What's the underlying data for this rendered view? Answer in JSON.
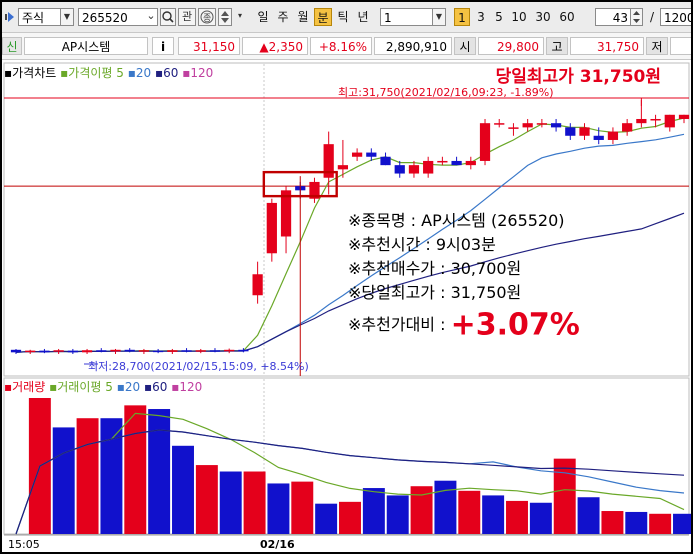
{
  "toolbar": {
    "category": "주식",
    "code": "265520",
    "btn_related": "관",
    "periods": [
      "일",
      "주",
      "월",
      "분",
      "틱",
      "년"
    ],
    "period_selected": "분",
    "interval_value": "1",
    "quick_intervals": [
      "1",
      "3",
      "5",
      "10",
      "30",
      "60"
    ],
    "quick_selected": "1",
    "count_value": "43",
    "total_value": "1200"
  },
  "quote": {
    "type_label": "신",
    "name": "AP시스템",
    "info_label": "i",
    "price": "31,150",
    "change": "▲2,350",
    "change_pct": "+8.16%",
    "volume": "2,890,910",
    "open_label": "시",
    "open": "29,800",
    "high_label": "고",
    "high": "31,750",
    "low_label": "저"
  },
  "legend_price": {
    "title": "가격차트",
    "ma_label": "가격이평 5",
    "ma2": "20",
    "ma3": "60",
    "ma4": "120"
  },
  "legend_volume": {
    "title": "거래량",
    "ma_label": "거래이평 5",
    "ma2": "20",
    "ma3": "60",
    "ma4": "120"
  },
  "annotations": {
    "day_high_title": "당일최고가 31,750원",
    "high_marker": "최고:31,750(2021/02/16,09:23, -1.89%)",
    "low_marker": "최저:28,700(2021/02/15,15:09, +8.54%)"
  },
  "info": {
    "row1": "※종목명 : AP시스템 (265520)",
    "row2": "※추천시간 : 9시03분",
    "row3": "※추천매수가 : 30,700원",
    "row4": "※당일최고가 : 31,750원",
    "row5_label": "※추천가대비 :",
    "row5_value": "+3.07%"
  },
  "x_labels": [
    "15:05",
    "02/16"
  ],
  "colors": {
    "up": "#e4001b",
    "down": "#1111cc",
    "ma5": "#6aa828",
    "ma20": "#3a78c9",
    "ma60": "#202080",
    "ma120": "#c040a0"
  },
  "chart_data": {
    "type": "candlestick",
    "price_high": 31750,
    "price_low": 28700,
    "recommend_price": 30700,
    "candles": [
      {
        "o": 28750,
        "h": 28760,
        "l": 28700,
        "c": 28720
      },
      {
        "o": 28730,
        "h": 28750,
        "l": 28700,
        "c": 28740
      },
      {
        "o": 28740,
        "h": 28760,
        "l": 28710,
        "c": 28720
      },
      {
        "o": 28730,
        "h": 28760,
        "l": 28700,
        "c": 28745
      },
      {
        "o": 28740,
        "h": 28760,
        "l": 28700,
        "c": 28720
      },
      {
        "o": 28720,
        "h": 28760,
        "l": 28700,
        "c": 28745
      },
      {
        "o": 28745,
        "h": 28770,
        "l": 28720,
        "c": 28730
      },
      {
        "o": 28730,
        "h": 28760,
        "l": 28700,
        "c": 28750
      },
      {
        "o": 28750,
        "h": 28770,
        "l": 28720,
        "c": 28730
      },
      {
        "o": 28730,
        "h": 28760,
        "l": 28700,
        "c": 28745
      },
      {
        "o": 28740,
        "h": 28760,
        "l": 28710,
        "c": 28725
      },
      {
        "o": 28725,
        "h": 28760,
        "l": 28700,
        "c": 28745
      },
      {
        "o": 28745,
        "h": 28770,
        "l": 28720,
        "c": 28730
      },
      {
        "o": 28730,
        "h": 28760,
        "l": 28710,
        "c": 28745
      },
      {
        "o": 28745,
        "h": 28770,
        "l": 28720,
        "c": 28735
      },
      {
        "o": 28735,
        "h": 28765,
        "l": 28710,
        "c": 28750
      },
      {
        "o": 28750,
        "h": 28770,
        "l": 28720,
        "c": 28732
      },
      {
        "o": 29400,
        "h": 29800,
        "l": 29300,
        "c": 29650
      },
      {
        "o": 29900,
        "h": 30550,
        "l": 29800,
        "c": 30500
      },
      {
        "o": 30100,
        "h": 30700,
        "l": 29900,
        "c": 30650
      },
      {
        "o": 30700,
        "h": 30750,
        "l": 30550,
        "c": 30650
      },
      {
        "o": 30550,
        "h": 30800,
        "l": 30500,
        "c": 30750
      },
      {
        "o": 30800,
        "h": 31350,
        "l": 30600,
        "c": 31200
      },
      {
        "o": 30900,
        "h": 31250,
        "l": 30800,
        "c": 30950
      },
      {
        "o": 31050,
        "h": 31150,
        "l": 31000,
        "c": 31100
      },
      {
        "o": 31100,
        "h": 31150,
        "l": 31000,
        "c": 31050
      },
      {
        "o": 31050,
        "h": 31100,
        "l": 30950,
        "c": 30950
      },
      {
        "o": 30950,
        "h": 31000,
        "l": 30800,
        "c": 30850
      },
      {
        "o": 30850,
        "h": 31000,
        "l": 30800,
        "c": 30950
      },
      {
        "o": 30850,
        "h": 31050,
        "l": 30800,
        "c": 31000
      },
      {
        "o": 31000,
        "h": 31050,
        "l": 30950,
        "c": 31000
      },
      {
        "o": 31000,
        "h": 31050,
        "l": 30950,
        "c": 30950
      },
      {
        "o": 30950,
        "h": 31050,
        "l": 30900,
        "c": 31000
      },
      {
        "o": 31000,
        "h": 31500,
        "l": 30950,
        "c": 31450
      },
      {
        "o": 31450,
        "h": 31500,
        "l": 31400,
        "c": 31450
      },
      {
        "o": 31400,
        "h": 31450,
        "l": 31300,
        "c": 31400
      },
      {
        "o": 31400,
        "h": 31500,
        "l": 31350,
        "c": 31450
      },
      {
        "o": 31450,
        "h": 31500,
        "l": 31400,
        "c": 31450
      },
      {
        "o": 31450,
        "h": 31500,
        "l": 31350,
        "c": 31400
      },
      {
        "o": 31400,
        "h": 31450,
        "l": 31250,
        "c": 31300
      },
      {
        "o": 31300,
        "h": 31450,
        "l": 31250,
        "c": 31400
      },
      {
        "o": 31300,
        "h": 31400,
        "l": 31200,
        "c": 31250
      },
      {
        "o": 31250,
        "h": 31400,
        "l": 31200,
        "c": 31350
      },
      {
        "o": 31350,
        "h": 31500,
        "l": 31300,
        "c": 31450
      },
      {
        "o": 31450,
        "h": 31750,
        "l": 31400,
        "c": 31500
      },
      {
        "o": 31500,
        "h": 31550,
        "l": 31400,
        "c": 31500
      },
      {
        "o": 31400,
        "h": 31550,
        "l": 31350,
        "c": 31550
      },
      {
        "o": 31500,
        "h": 31550,
        "l": 31450,
        "c": 31550
      }
    ],
    "volume": [
      {
        "v": 0,
        "up": true
      },
      {
        "v": 148,
        "up": true
      },
      {
        "v": 116,
        "up": false
      },
      {
        "v": 126,
        "up": true
      },
      {
        "v": 126,
        "up": false
      },
      {
        "v": 140,
        "up": true
      },
      {
        "v": 136,
        "up": false
      },
      {
        "v": 96,
        "up": false
      },
      {
        "v": 75,
        "up": true
      },
      {
        "v": 68,
        "up": false
      },
      {
        "v": 68,
        "up": true
      },
      {
        "v": 55,
        "up": false
      },
      {
        "v": 57,
        "up": true
      },
      {
        "v": 33,
        "up": false
      },
      {
        "v": 35,
        "up": true
      },
      {
        "v": 50,
        "up": false
      },
      {
        "v": 42,
        "up": false
      },
      {
        "v": 52,
        "up": true
      },
      {
        "v": 58,
        "up": false
      },
      {
        "v": 47,
        "up": true
      },
      {
        "v": 42,
        "up": false
      },
      {
        "v": 36,
        "up": true
      },
      {
        "v": 34,
        "up": false
      },
      {
        "v": 82,
        "up": true
      },
      {
        "v": 40,
        "up": false
      },
      {
        "v": 25,
        "up": true
      },
      {
        "v": 24,
        "up": false
      },
      {
        "v": 22,
        "up": true
      },
      {
        "v": 22,
        "up": false
      }
    ],
    "x_labels": [
      "15:05",
      "02/16"
    ]
  }
}
